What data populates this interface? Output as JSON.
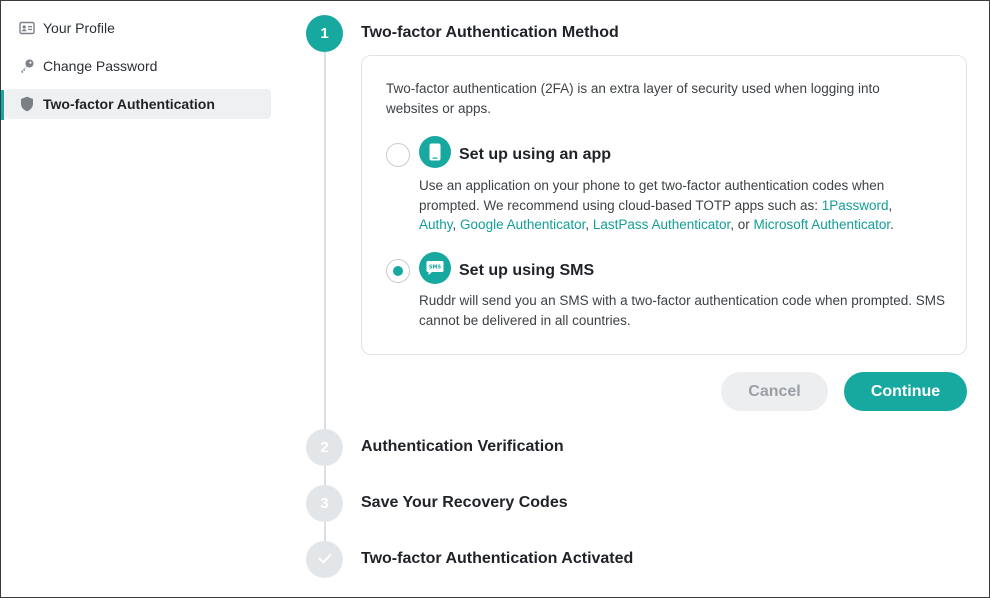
{
  "sidebar": {
    "items": [
      {
        "label": "Your Profile",
        "icon": "id-card-icon"
      },
      {
        "label": "Change Password",
        "icon": "key-icon"
      },
      {
        "label": "Two-factor Authentication",
        "icon": "shield-icon",
        "active": true
      }
    ]
  },
  "steps": [
    {
      "number": "1",
      "title": "Two-factor Authentication Method",
      "state": "active"
    },
    {
      "number": "2",
      "title": "Authentication Verification",
      "state": "inactive"
    },
    {
      "number": "3",
      "title": "Save Your Recovery Codes",
      "state": "inactive"
    },
    {
      "number": "",
      "icon": "check-icon",
      "title": "Two-factor Authentication Activated",
      "state": "inactive"
    }
  ],
  "method": {
    "intro": "Two-factor authentication (2FA) is an extra layer of security used when logging into websites or apps.",
    "options": [
      {
        "title": "Set up using an app",
        "icon": "phone-icon",
        "selected": false,
        "desc_prefix": "Use an application on your phone to get two-factor authentication codes when prompted. We recommend using cloud-based TOTP apps such as: ",
        "links": [
          "1Password",
          "Authy",
          "Google Authenticator",
          "LastPass Authenticator",
          "Microsoft Authenticator"
        ],
        "sep1": ",",
        "sep2": ", ",
        "sep3": ", ",
        "sep4": ", or ",
        "end": "."
      },
      {
        "title": "Set up using SMS",
        "icon": "sms-icon",
        "icon_text": "SMS",
        "selected": true,
        "desc": "Ruddr will send you an SMS with a two-factor authentication code when prompted. SMS cannot be delivered in all countries."
      }
    ]
  },
  "buttons": {
    "cancel": "Cancel",
    "continue": "Continue"
  },
  "colors": {
    "accent": "#17a99f",
    "link": "#129e96",
    "inactive_step": "#e3e6e9"
  }
}
